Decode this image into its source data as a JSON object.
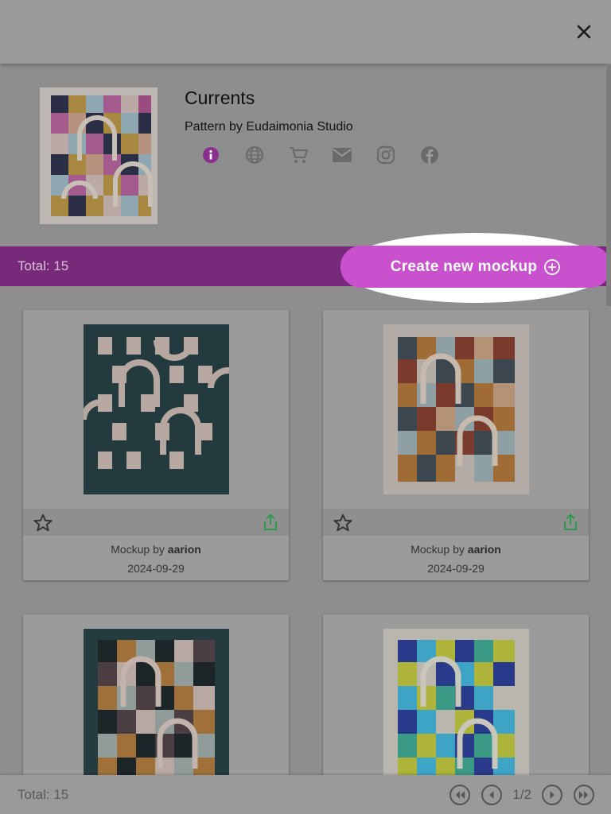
{
  "header": {
    "close_label": "Close"
  },
  "pattern": {
    "title": "Currents",
    "subtitle": "Pattern by Eudaimonia Studio",
    "icons": [
      "info-icon",
      "globe-icon",
      "cart-icon",
      "mail-icon",
      "instagram-icon",
      "facebook-icon"
    ]
  },
  "toolbar": {
    "total_label": "Total: 15",
    "create_label": "Create new mockup"
  },
  "mockups": [
    {
      "by_prefix": "Mockup by ",
      "author": "aarion",
      "date": "2024-09-29"
    },
    {
      "by_prefix": "Mockup by ",
      "author": "aarion",
      "date": "2024-09-29"
    },
    {
      "by_prefix": "",
      "author": "",
      "date": ""
    },
    {
      "by_prefix": "",
      "author": "",
      "date": ""
    }
  ],
  "footer": {
    "total_label": "Total: 15",
    "page_indicator": "1/2"
  },
  "colors": {
    "accent": "#c951ce",
    "bar": "#77297a",
    "share": "#2e9a4c"
  }
}
